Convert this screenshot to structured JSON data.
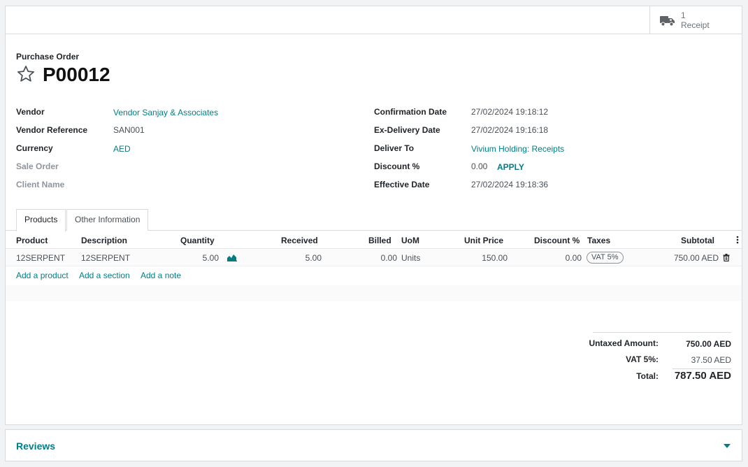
{
  "stat_button": {
    "count": "1",
    "label": "Receipt",
    "icon": "truck-icon"
  },
  "header": {
    "label": "Purchase Order",
    "name": "P00012"
  },
  "left_fields": [
    {
      "label": "Vendor",
      "value": "Vendor Sanjay & Associates"
    },
    {
      "label": "Vendor Reference",
      "value": "SAN001"
    },
    {
      "label": "Currency",
      "value": "AED"
    },
    {
      "label": "Sale Order",
      "value": ""
    },
    {
      "label": "Client Name",
      "value": ""
    }
  ],
  "right_fields": [
    {
      "label": "Confirmation Date",
      "value": "27/02/2024 19:18:12"
    },
    {
      "label": "Ex-Delivery Date",
      "value": "27/02/2024 19:16:18"
    },
    {
      "label": "Deliver To",
      "value": "Vivium Holding: Receipts"
    },
    {
      "label": "Discount %",
      "value": "0.00",
      "action": "APPLY"
    },
    {
      "label": "Effective Date",
      "value": "27/02/2024 19:18:36"
    }
  ],
  "tabs": [
    "Products",
    "Other Information"
  ],
  "columns": [
    "Product",
    "Description",
    "Quantity",
    "Received",
    "Billed",
    "UoM",
    "Unit Price",
    "Discount %",
    "Taxes",
    "Subtotal"
  ],
  "lines": [
    {
      "product": "12SERPENT",
      "description": "12SERPENT",
      "quantity": "5.00",
      "received": "5.00",
      "billed": "0.00",
      "uom": "Units",
      "unit_price": "150.00",
      "discount": "0.00",
      "taxes": "VAT 5%",
      "subtotal": "750.00 AED"
    }
  ],
  "add_links": [
    "Add a product",
    "Add a section",
    "Add a note"
  ],
  "totals": {
    "untaxed_label": "Untaxed Amount:",
    "untaxed_value": "750.00 AED",
    "vat_label": "VAT 5%:",
    "vat_value": "37.50 AED",
    "total_label": "Total:",
    "total_value": "787.50 AED"
  },
  "reviews": {
    "title": "Reviews"
  },
  "colors": {
    "accent": "#017e84",
    "text": "#212529",
    "muted": "#8f959b",
    "border": "#d8dadd"
  }
}
